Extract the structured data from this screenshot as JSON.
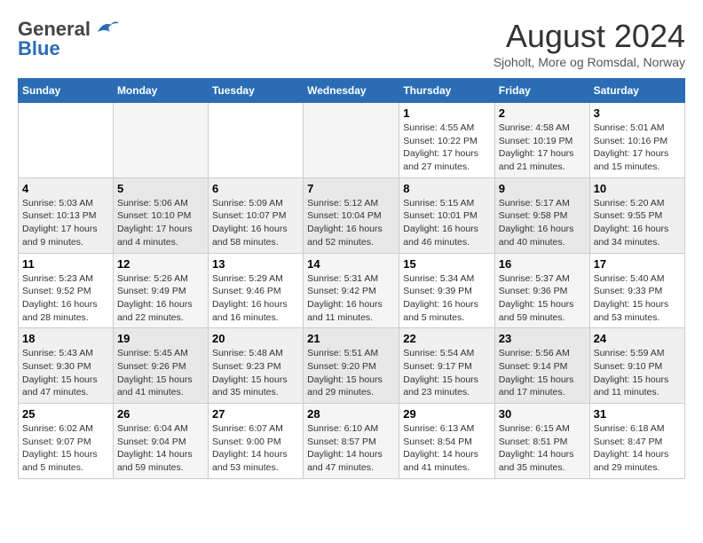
{
  "header": {
    "logo_general": "General",
    "logo_blue": "Blue",
    "month_title": "August 2024",
    "location": "Sjoholt, More og Romsdal, Norway"
  },
  "days_of_week": [
    "Sunday",
    "Monday",
    "Tuesday",
    "Wednesday",
    "Thursday",
    "Friday",
    "Saturday"
  ],
  "weeks": [
    [
      {
        "day": "",
        "info": ""
      },
      {
        "day": "",
        "info": ""
      },
      {
        "day": "",
        "info": ""
      },
      {
        "day": "",
        "info": ""
      },
      {
        "day": "1",
        "info": "Sunrise: 4:55 AM\nSunset: 10:22 PM\nDaylight: 17 hours\nand 27 minutes."
      },
      {
        "day": "2",
        "info": "Sunrise: 4:58 AM\nSunset: 10:19 PM\nDaylight: 17 hours\nand 21 minutes."
      },
      {
        "day": "3",
        "info": "Sunrise: 5:01 AM\nSunset: 10:16 PM\nDaylight: 17 hours\nand 15 minutes."
      }
    ],
    [
      {
        "day": "4",
        "info": "Sunrise: 5:03 AM\nSunset: 10:13 PM\nDaylight: 17 hours\nand 9 minutes."
      },
      {
        "day": "5",
        "info": "Sunrise: 5:06 AM\nSunset: 10:10 PM\nDaylight: 17 hours\nand 4 minutes."
      },
      {
        "day": "6",
        "info": "Sunrise: 5:09 AM\nSunset: 10:07 PM\nDaylight: 16 hours\nand 58 minutes."
      },
      {
        "day": "7",
        "info": "Sunrise: 5:12 AM\nSunset: 10:04 PM\nDaylight: 16 hours\nand 52 minutes."
      },
      {
        "day": "8",
        "info": "Sunrise: 5:15 AM\nSunset: 10:01 PM\nDaylight: 16 hours\nand 46 minutes."
      },
      {
        "day": "9",
        "info": "Sunrise: 5:17 AM\nSunset: 9:58 PM\nDaylight: 16 hours\nand 40 minutes."
      },
      {
        "day": "10",
        "info": "Sunrise: 5:20 AM\nSunset: 9:55 PM\nDaylight: 16 hours\nand 34 minutes."
      }
    ],
    [
      {
        "day": "11",
        "info": "Sunrise: 5:23 AM\nSunset: 9:52 PM\nDaylight: 16 hours\nand 28 minutes."
      },
      {
        "day": "12",
        "info": "Sunrise: 5:26 AM\nSunset: 9:49 PM\nDaylight: 16 hours\nand 22 minutes."
      },
      {
        "day": "13",
        "info": "Sunrise: 5:29 AM\nSunset: 9:46 PM\nDaylight: 16 hours\nand 16 minutes."
      },
      {
        "day": "14",
        "info": "Sunrise: 5:31 AM\nSunset: 9:42 PM\nDaylight: 16 hours\nand 11 minutes."
      },
      {
        "day": "15",
        "info": "Sunrise: 5:34 AM\nSunset: 9:39 PM\nDaylight: 16 hours\nand 5 minutes."
      },
      {
        "day": "16",
        "info": "Sunrise: 5:37 AM\nSunset: 9:36 PM\nDaylight: 15 hours\nand 59 minutes."
      },
      {
        "day": "17",
        "info": "Sunrise: 5:40 AM\nSunset: 9:33 PM\nDaylight: 15 hours\nand 53 minutes."
      }
    ],
    [
      {
        "day": "18",
        "info": "Sunrise: 5:43 AM\nSunset: 9:30 PM\nDaylight: 15 hours\nand 47 minutes."
      },
      {
        "day": "19",
        "info": "Sunrise: 5:45 AM\nSunset: 9:26 PM\nDaylight: 15 hours\nand 41 minutes."
      },
      {
        "day": "20",
        "info": "Sunrise: 5:48 AM\nSunset: 9:23 PM\nDaylight: 15 hours\nand 35 minutes."
      },
      {
        "day": "21",
        "info": "Sunrise: 5:51 AM\nSunset: 9:20 PM\nDaylight: 15 hours\nand 29 minutes."
      },
      {
        "day": "22",
        "info": "Sunrise: 5:54 AM\nSunset: 9:17 PM\nDaylight: 15 hours\nand 23 minutes."
      },
      {
        "day": "23",
        "info": "Sunrise: 5:56 AM\nSunset: 9:14 PM\nDaylight: 15 hours\nand 17 minutes."
      },
      {
        "day": "24",
        "info": "Sunrise: 5:59 AM\nSunset: 9:10 PM\nDaylight: 15 hours\nand 11 minutes."
      }
    ],
    [
      {
        "day": "25",
        "info": "Sunrise: 6:02 AM\nSunset: 9:07 PM\nDaylight: 15 hours\nand 5 minutes."
      },
      {
        "day": "26",
        "info": "Sunrise: 6:04 AM\nSunset: 9:04 PM\nDaylight: 14 hours\nand 59 minutes."
      },
      {
        "day": "27",
        "info": "Sunrise: 6:07 AM\nSunset: 9:00 PM\nDaylight: 14 hours\nand 53 minutes."
      },
      {
        "day": "28",
        "info": "Sunrise: 6:10 AM\nSunset: 8:57 PM\nDaylight: 14 hours\nand 47 minutes."
      },
      {
        "day": "29",
        "info": "Sunrise: 6:13 AM\nSunset: 8:54 PM\nDaylight: 14 hours\nand 41 minutes."
      },
      {
        "day": "30",
        "info": "Sunrise: 6:15 AM\nSunset: 8:51 PM\nDaylight: 14 hours\nand 35 minutes."
      },
      {
        "day": "31",
        "info": "Sunrise: 6:18 AM\nSunset: 8:47 PM\nDaylight: 14 hours\nand 29 minutes."
      }
    ]
  ]
}
